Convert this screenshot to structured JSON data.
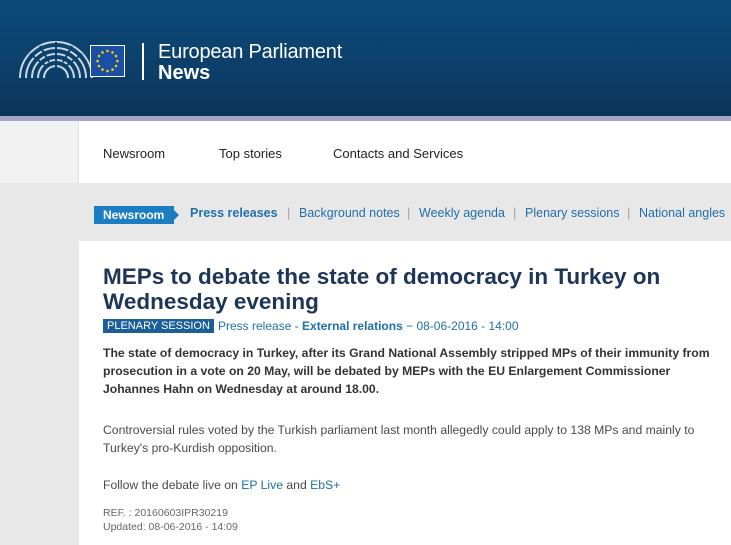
{
  "header": {
    "brand_title": "European Parliament",
    "brand_sub": "News",
    "logo_icon": "parliament-hemicycle-icon",
    "flag_icon": "eu-flag-icon"
  },
  "topnav": {
    "items": [
      {
        "label": "Newsroom",
        "active": true
      },
      {
        "label": "Top stories",
        "active": false
      },
      {
        "label": "Contacts and Services",
        "active": false
      }
    ]
  },
  "subnav": {
    "current": "Newsroom",
    "items": [
      {
        "label": "Press releases",
        "active": true
      },
      {
        "label": "Background notes",
        "active": false
      },
      {
        "label": "Weekly agenda",
        "active": false
      },
      {
        "label": "Plenary sessions",
        "active": false
      },
      {
        "label": "National angles",
        "active": false
      }
    ]
  },
  "article": {
    "title": "MEPs to debate the state of democracy in Turkey on Wednesday evening",
    "badge": "PLENARY SESSION",
    "type": "Press release",
    "sep1": " - ",
    "category": "External relations",
    "sep2": " − ",
    "date": "08-06-2016 - 14:00",
    "lead": "The state of democracy in Turkey, after its Grand National Assembly stripped MPs of their immunity from prosecution in a vote on 20 May, will be debated by MEPs with the EU Enlargement Commissioner Johannes Hahn on Wednesday at around 18.00.",
    "paragraph": "Controversial rules voted by the Turkish parliament last month allegedly could apply to 138 MPs and mainly to Turkey's pro-Kurdish opposition.",
    "follow_prefix": "Follow the debate live on ",
    "follow_link1": "EP Live",
    "follow_and": " and ",
    "follow_link2": "EbS+",
    "ref": "REF. : 20160603IPR30219",
    "updated": "Updated: 08-06-2016 - 14:09"
  },
  "colors": {
    "header_bg": "#0c3f69",
    "accent_blue": "#1b7ec3",
    "title_color": "#1d3557",
    "link_color": "#1f6fad"
  }
}
